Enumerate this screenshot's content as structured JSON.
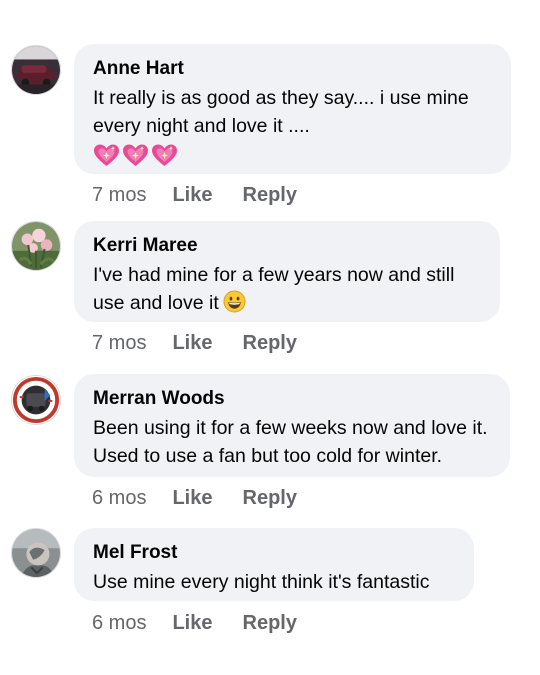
{
  "comments": [
    {
      "author": "Anne Hart",
      "text": "It really is as good as they say.... i use mine every night and love it ....",
      "emoji": [
        "sparkling-heart-icon",
        "sparkling-heart-icon",
        "sparkling-heart-icon"
      ],
      "time": "7 mos",
      "like_label": "Like",
      "reply_label": "Reply"
    },
    {
      "author": "Kerri Maree",
      "text": "I've had mine for a few years now and still use and love it",
      "emoji": [
        "grinning-face-icon"
      ],
      "time": "7 mos",
      "like_label": "Like",
      "reply_label": "Reply"
    },
    {
      "author": "Merran Woods",
      "text": "Been using it for a few weeks now and love it. Used to use a fan but too cold for winter.",
      "time": "6 mos",
      "like_label": "Like",
      "reply_label": "Reply"
    },
    {
      "author": "Mel Frost",
      "text": "Use mine every night think it's fantastic",
      "time": "6 mos",
      "like_label": "Like",
      "reply_label": "Reply"
    }
  ],
  "colors": {
    "bubble": "#f0f2f5",
    "text": "#050505",
    "meta": "#65676b",
    "heart": "#e0408a"
  }
}
